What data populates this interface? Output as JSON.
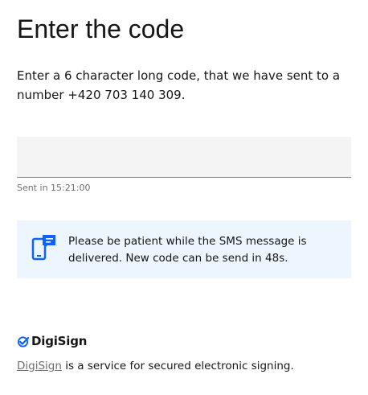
{
  "page": {
    "title": "Enter the code",
    "instructions": "Enter a 6 character long code, that we have sent to a number +420 703 140 309."
  },
  "code_field": {
    "value": "",
    "placeholder": "",
    "sent_time": "Sent in 15:21:00"
  },
  "sms_notice": {
    "icon": "mobile-message-icon",
    "text": "Please be patient while the SMS message is delivered. New code can be send in 48s."
  },
  "footer": {
    "brand_icon": "checkmark-icon",
    "brand_name": "DigiSign",
    "link_text": "DigiSign",
    "description": " is a service for secured electronic signing."
  },
  "colors": {
    "accent": "#0f62fe",
    "notice_background": "#edf5ff",
    "input_background": "#f4f4f4",
    "text": "#161616",
    "helper_text": "#6f6f6f"
  }
}
